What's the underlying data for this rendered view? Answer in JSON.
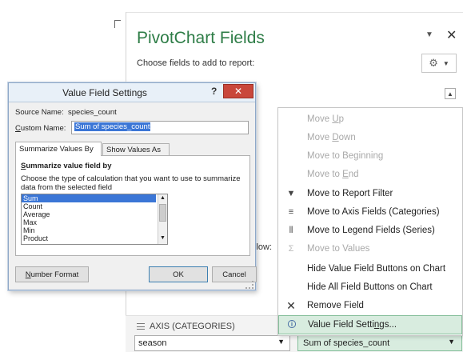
{
  "pane": {
    "title": "PivotChart Fields",
    "subtitle": "Choose fields to add to report:",
    "close_glyph": "✕",
    "dropdown_glyph": "▼",
    "gear_glyph": "⚙",
    "gear_caret": "▼",
    "scroll_glyph": "▲",
    "truncated_text": "llow:",
    "axis_section_label": "AXIS (CATEGORIES)",
    "axis_field_value": "season",
    "values_field_value": "Sum of species_count",
    "field_arrow": "▼"
  },
  "context_menu": {
    "items": [
      {
        "label": "Move Up",
        "icon": "",
        "disabled": true
      },
      {
        "label": "Move Down",
        "icon": "",
        "disabled": true
      },
      {
        "label": "Move to Beginning",
        "icon": "",
        "disabled": true
      },
      {
        "label": "Move to End",
        "icon": "",
        "disabled": true
      },
      {
        "label": "Move to Report Filter",
        "icon": "filter-icon",
        "disabled": false
      },
      {
        "label": "Move to Axis Fields (Categories)",
        "icon": "rows-icon",
        "disabled": false
      },
      {
        "label": "Move to Legend Fields (Series)",
        "icon": "columns-icon",
        "disabled": false
      },
      {
        "label": "Move to Values",
        "icon": "sigma-icon",
        "disabled": true
      },
      {
        "label": "Hide Value Field Buttons on Chart",
        "icon": "",
        "disabled": false
      },
      {
        "label": "Hide All Field Buttons on Chart",
        "icon": "",
        "disabled": false
      },
      {
        "label": "Remove Field",
        "icon": "remove-x-icon",
        "disabled": false
      },
      {
        "label": "Value Field Settings...",
        "icon": "field-settings-icon",
        "disabled": false,
        "highlighted": true
      }
    ],
    "icon_glyphs": {
      "filter": "▼",
      "rows": "≡",
      "columns": "⦀",
      "sigma": "Σ",
      "remove": "✕",
      "settings": "🛈"
    }
  },
  "dialog": {
    "title": "Value Field Settings",
    "help_glyph": "?",
    "close_glyph": "✕",
    "source_name_label": "Source Name:",
    "source_name_value": "species_count",
    "custom_name_label": "Custom Name:",
    "custom_name_value": "Sum of species_count",
    "tabs": [
      "Summarize Values By",
      "Show Values As"
    ],
    "section_heading": "Summarize value field by",
    "section_description": "Choose the type of calculation that you want to use to summarize data from the selected field",
    "functions": [
      "Sum",
      "Count",
      "Average",
      "Max",
      "Min",
      "Product"
    ],
    "selected_function": "Sum",
    "number_format_label": "Number Format",
    "ok_label": "OK",
    "cancel_label": "Cancel"
  }
}
